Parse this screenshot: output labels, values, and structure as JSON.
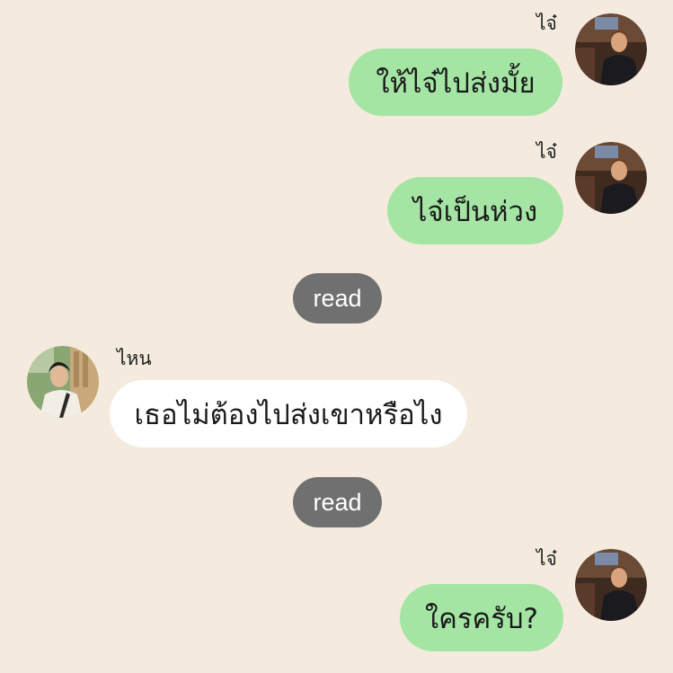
{
  "colors": {
    "background": "#f4ebde",
    "outgoing_bubble": "#a4e5a4",
    "incoming_bubble": "#ffffff",
    "read_pill": "#707070"
  },
  "messages": [
    {
      "sender": "ไจ๋",
      "text": "ให้ไจ๋ไปส่งมั้ย",
      "direction": "outgoing",
      "avatar_icon": "profile-photo-dark-jacket"
    },
    {
      "sender": "ไจ๋",
      "text": "ไจ๋เป็นห่วง",
      "direction": "outgoing",
      "avatar_icon": "profile-photo-dark-jacket"
    },
    {
      "status": "read"
    },
    {
      "sender": "ไหน",
      "text": "เธอไม่ต้องไปส่งเขาหรือไง",
      "direction": "incoming",
      "avatar_icon": "profile-photo-white-shirt"
    },
    {
      "status": "read"
    },
    {
      "sender": "ไจ๋",
      "text": "ใครครับ?",
      "direction": "outgoing",
      "avatar_icon": "profile-photo-dark-jacket"
    }
  ]
}
